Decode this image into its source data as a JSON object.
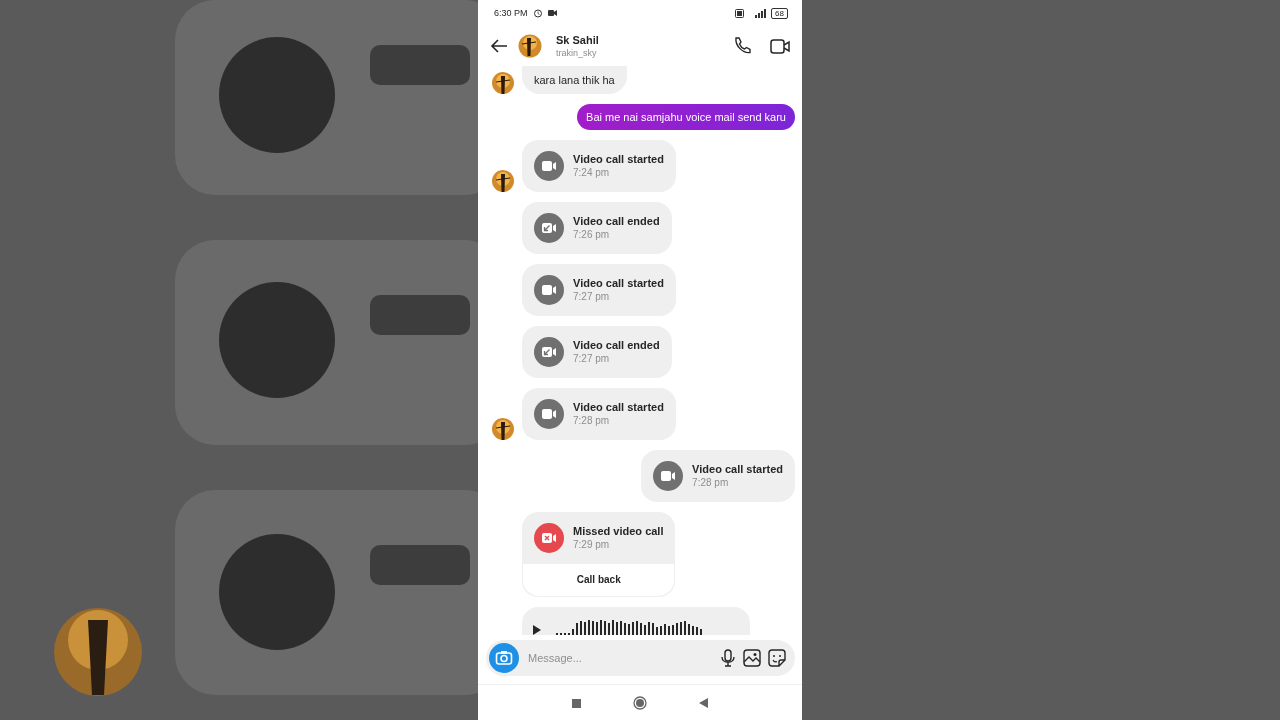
{
  "status_bar": {
    "time": "6:30 PM",
    "battery": "68"
  },
  "header": {
    "name": "Sk Sahil",
    "username": "trakin_sky"
  },
  "messages": [
    {
      "kind": "text",
      "outgoing": false,
      "avatar": true,
      "text": "kara lana thik ha"
    },
    {
      "kind": "text",
      "outgoing": true,
      "text": "Bai me nai samjahu voice mail send karu"
    },
    {
      "kind": "callstarted",
      "outgoing": false,
      "avatar": true,
      "title": "Video call started",
      "time": "7:24 pm"
    },
    {
      "kind": "callended",
      "outgoing": false,
      "avatar": false,
      "title": "Video call ended",
      "time": "7:26 pm"
    },
    {
      "kind": "callstarted",
      "outgoing": false,
      "avatar": false,
      "title": "Video call started",
      "time": "7:27 pm"
    },
    {
      "kind": "callended",
      "outgoing": false,
      "avatar": false,
      "title": "Video call ended",
      "time": "7:27 pm"
    },
    {
      "kind": "callstarted",
      "outgoing": false,
      "avatar": true,
      "title": "Video call started",
      "time": "7:28 pm"
    },
    {
      "kind": "callstarted",
      "outgoing": true,
      "title": "Video call started",
      "time": "7:28 pm"
    },
    {
      "kind": "callmissed",
      "outgoing": false,
      "avatar": false,
      "title": "Missed video call",
      "time": "7:29 pm",
      "action": "Call back"
    },
    {
      "kind": "voice",
      "outgoing": false,
      "avatar": false
    }
  ],
  "composer": {
    "placeholder": "Message..."
  }
}
